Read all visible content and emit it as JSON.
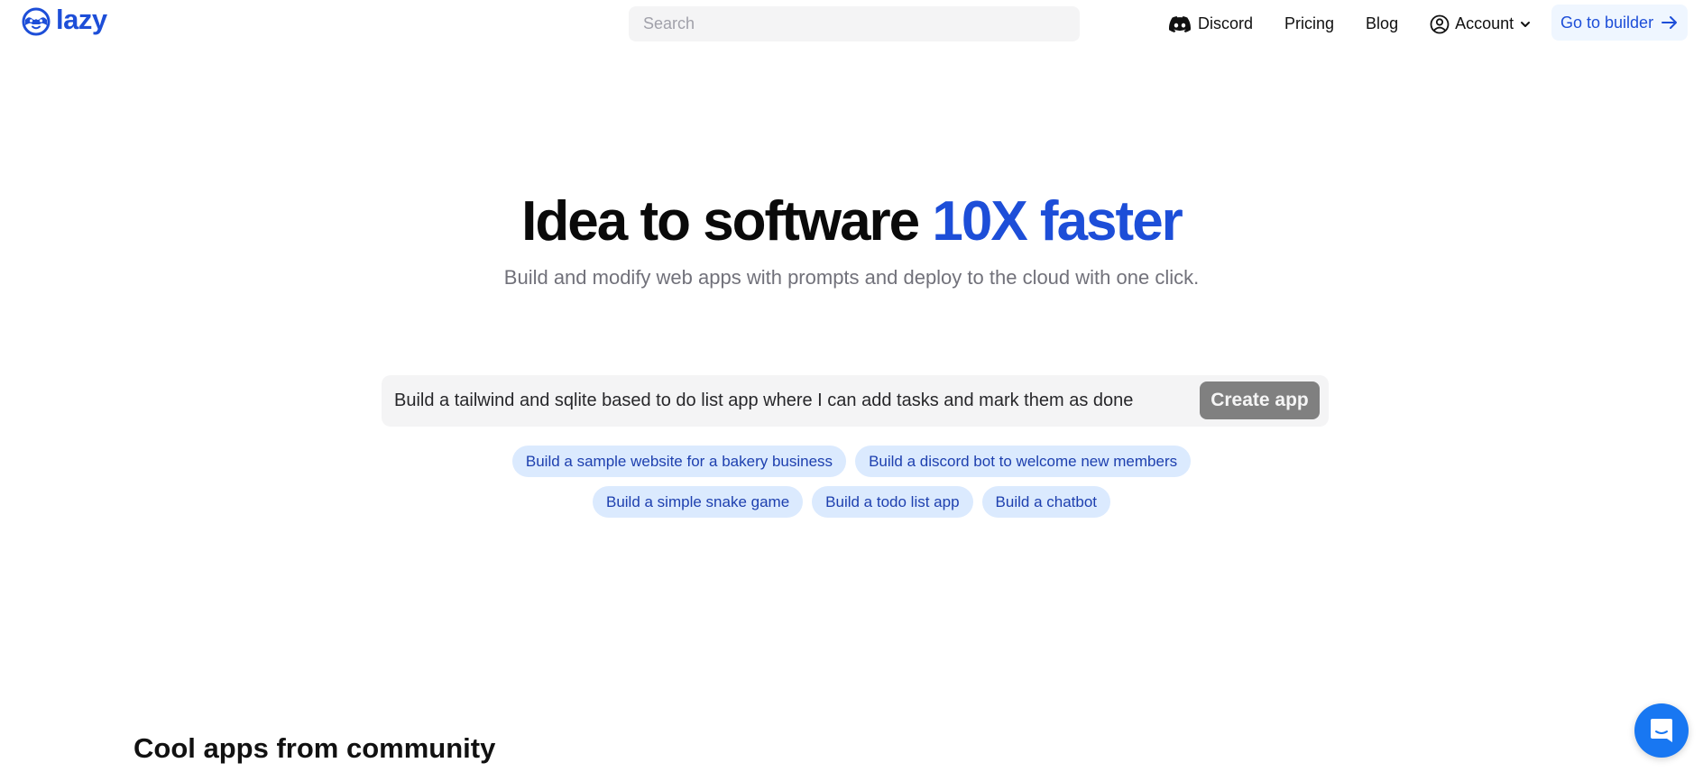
{
  "header": {
    "logo_text": "lazy",
    "search_placeholder": "Search",
    "nav": {
      "discord": "Discord",
      "pricing": "Pricing",
      "blog": "Blog",
      "account": "Account",
      "builder": "Go to builder"
    }
  },
  "hero": {
    "title_main": "Idea to software ",
    "title_accent": "10X faster",
    "subtitle": "Build and modify web apps with prompts and deploy to the cloud with one click."
  },
  "prompt": {
    "value": "Build a tailwind and sqlite based to do list app where I can add tasks and mark them as done",
    "button_label": "Create app"
  },
  "suggestions": [
    "Build a sample website for a bakery business",
    "Build a discord bot to welcome new members",
    "Build a simple snake game",
    "Build a todo list app",
    "Build a chatbot"
  ],
  "community": {
    "title": "Cool apps from community"
  },
  "colors": {
    "brand": "#1d4ed8",
    "chip_bg": "#dbeafe",
    "chat_widget": "#1877f2"
  }
}
